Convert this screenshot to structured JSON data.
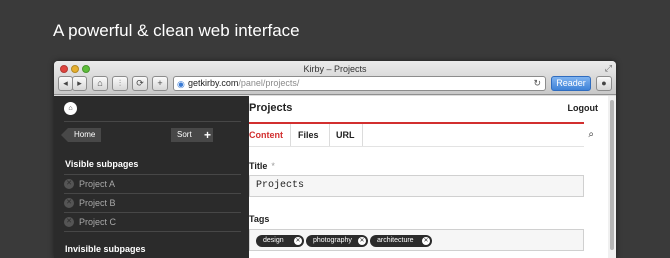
{
  "headline": "A powerful & clean web interface",
  "browser": {
    "window_title": "Kirby – Projects",
    "address_host": "getkirby.com",
    "address_path": "/panel/projects/",
    "reader_label": "Reader",
    "toolbar_buttons": [
      "◂",
      "▸",
      "⌂",
      "⫶",
      "⟳",
      "+"
    ]
  },
  "sidebar": {
    "breadcrumb_home": "Home",
    "sort_label": "Sort",
    "visible_heading": "Visible subpages",
    "visible_items": [
      "Project A",
      "Project B",
      "Project C"
    ],
    "invisible_heading": "Invisible subpages"
  },
  "main": {
    "title": "Projects",
    "logout_label": "Logout",
    "tabs": [
      {
        "label": "Content",
        "active": true
      },
      {
        "label": "Files",
        "active": false
      },
      {
        "label": "URL",
        "active": false
      }
    ],
    "title_field": {
      "label": "Title",
      "required_mark": "*",
      "value": "Projects"
    },
    "tags_field": {
      "label": "Tags",
      "tags": [
        "design",
        "photography",
        "architecture"
      ]
    }
  },
  "colors": {
    "accent": "#d22f2f",
    "sidebar_bg": "#2b2b2b",
    "page_bg": "#3a3a3a"
  }
}
